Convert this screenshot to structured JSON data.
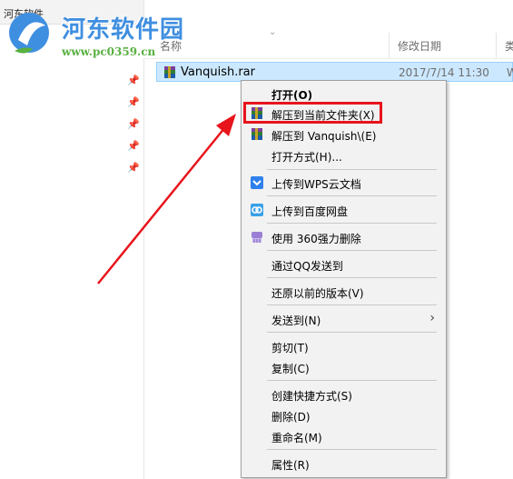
{
  "window": {
    "folder_title": "河东软件"
  },
  "watermark": {
    "title": "河东软件园",
    "url": "www.pc0359.cn"
  },
  "columns": {
    "name": "名称",
    "date_modified": "修改日期",
    "type": "类"
  },
  "file": {
    "name": "Vanquish.rar",
    "date": "2017/7/14 11:30",
    "type": "W"
  },
  "context_menu": {
    "open": "打开(O)",
    "extract_here": "解压到当前文件夹(X)",
    "extract_to": "解压到 Vanquish\\(E)",
    "open_with": "打开方式(H)...",
    "upload_wps": "上传到WPS云文档",
    "upload_baidu": "上传到百度网盘",
    "force_delete_360": "使用 360强力删除",
    "send_qq": "通过QQ发送到",
    "restore_versions": "还原以前的版本(V)",
    "send_to": "发送到(N)",
    "cut": "剪切(T)",
    "copy": "复制(C)",
    "create_shortcut": "创建快捷方式(S)",
    "delete": "删除(D)",
    "rename": "重命名(M)",
    "properties": "属性(R)"
  },
  "colors": {
    "selection_bg": "#cce8ff",
    "highlight_box": "#e8141c",
    "arrow": "#e8141c",
    "menu_bg": "#f2f2f2"
  },
  "icons": {
    "winrar": "winrar-icon",
    "wps_cloud": "wps-cloud-icon",
    "baidu_netdisk": "baidu-netdisk-icon",
    "shred_360": "360-shred-icon",
    "pin": "pin-icon",
    "submenu": "chevron-right-icon"
  }
}
